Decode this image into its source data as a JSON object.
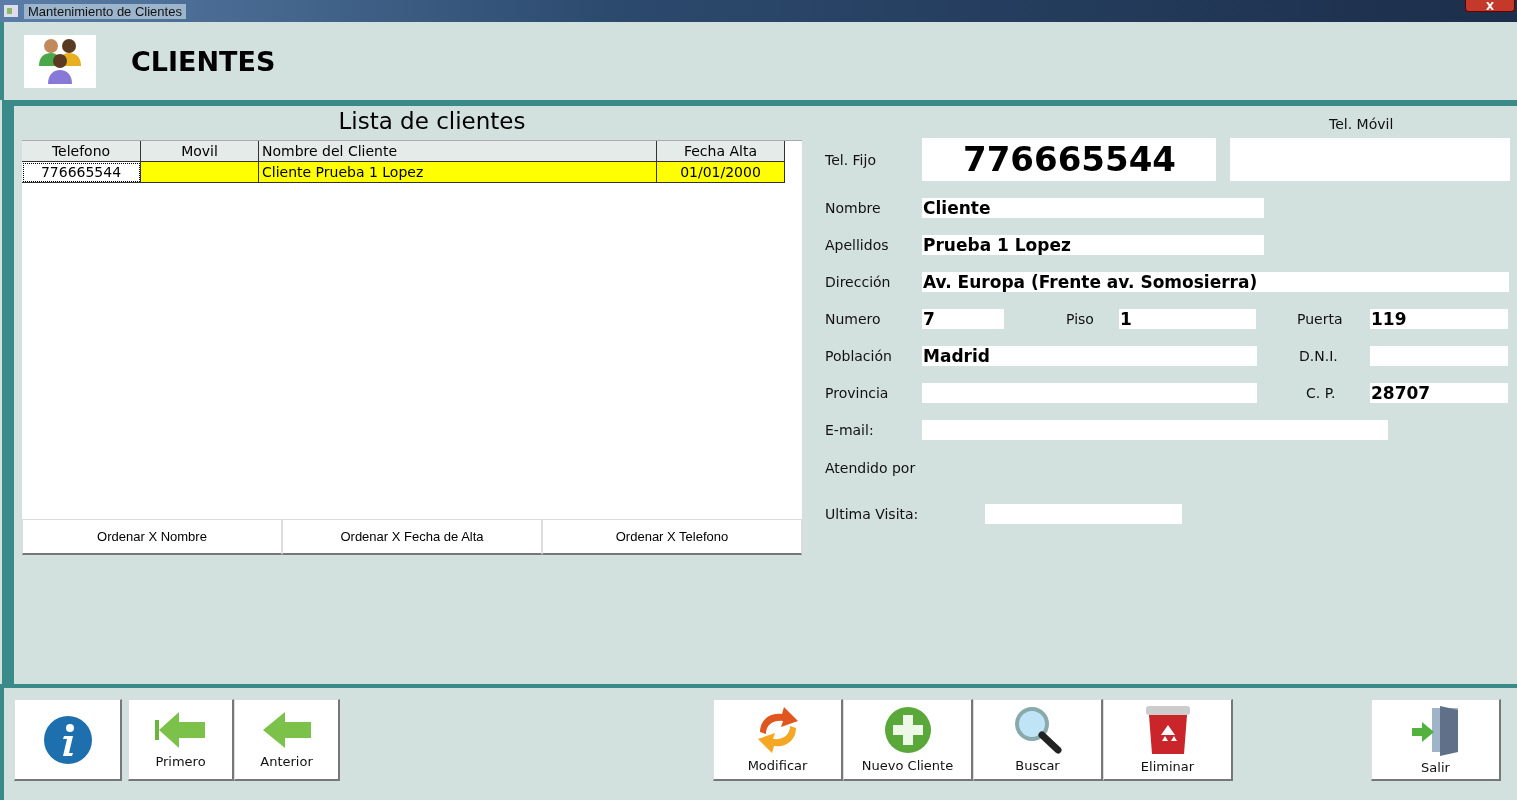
{
  "window": {
    "title": "Mantenimiento de Clientes"
  },
  "header": {
    "title": "CLIENTES"
  },
  "list": {
    "title": "Lista de clientes",
    "columns": [
      "Telefono",
      "Movil",
      "Nombre del Cliente",
      "Fecha Alta"
    ],
    "rows": [
      {
        "telefono": "776665544",
        "nombre": "Cliente Prueba 1 Lopez",
        "fecha_alta": "01/01/2000",
        "selected": true
      }
    ],
    "sort_buttons": [
      "Ordenar X Nombre",
      "Ordenar X Fecha de Alta",
      "Ordenar X Telefono"
    ]
  },
  "form": {
    "tel_fijo": {
      "label": "Tel. Fijo",
      "value": "776665544"
    },
    "tel_movil": {
      "label": "Tel. Móvil"
    },
    "nombre": {
      "label": "Nombre",
      "value": "Cliente"
    },
    "apellidos": {
      "label": "Apellidos",
      "value": "Prueba 1 Lopez"
    },
    "direccion": {
      "label": "Dirección",
      "value": "Av. Europa (Frente av. Somosierra)"
    },
    "numero": {
      "label": "Numero",
      "value": "7"
    },
    "piso": {
      "label": "Piso",
      "value": "1"
    },
    "puerta": {
      "label": "Puerta",
      "value": "119"
    },
    "poblacion": {
      "label": "Población",
      "value": "Madrid"
    },
    "dni": {
      "label": "D.N.I."
    },
    "provincia": {
      "label": "Provincia"
    },
    "cp": {
      "label": "C. P.",
      "value": "28707"
    },
    "email": {
      "label": "E-mail:"
    },
    "atendido_por": {
      "label": "Atendido por"
    },
    "ultima_visita": {
      "label": "Ultima Visita:"
    }
  },
  "toolbar": {
    "left": [
      {
        "kind": "info"
      },
      {
        "kind": "first",
        "label": "Primero"
      },
      {
        "kind": "previous",
        "label": "Anterior"
      }
    ],
    "middle": [
      {
        "kind": "modify",
        "label": "Modificar"
      },
      {
        "kind": "new",
        "label": "Nuevo Cliente"
      },
      {
        "kind": "search",
        "label": "Buscar"
      },
      {
        "kind": "delete",
        "label": "Eliminar"
      }
    ],
    "right": [
      {
        "kind": "exit",
        "label": "Salir"
      }
    ]
  }
}
